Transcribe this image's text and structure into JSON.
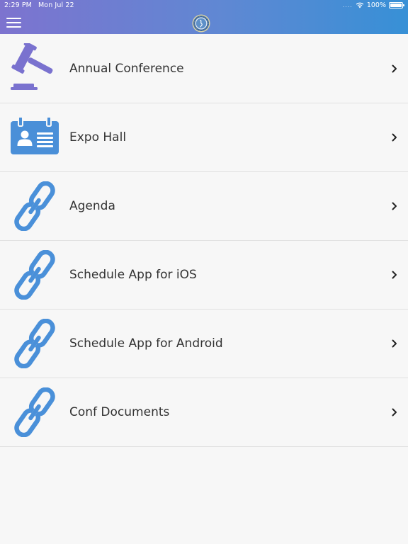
{
  "status_bar": {
    "time": "2:29 PM",
    "date": "Mon Jul 22",
    "signal": "....",
    "battery": "100%"
  },
  "header": {
    "menu_icon": "hamburger-icon",
    "logo_icon": "organization-seal-icon"
  },
  "colors": {
    "header_gradient_start": "#7d73cf",
    "header_gradient_end": "#3790d6",
    "gavel_purple": "#7a72cf",
    "expo_blue": "#4a8fd8",
    "link_blue": "#4a90d9",
    "background": "#f7f7f7",
    "text": "#333333"
  },
  "menu": {
    "items": [
      {
        "label": "Annual Conference",
        "icon": "gavel-icon"
      },
      {
        "label": "Expo Hall",
        "icon": "id-badge-icon"
      },
      {
        "label": "Agenda",
        "icon": "link-icon"
      },
      {
        "label": "Schedule App for iOS",
        "icon": "link-icon"
      },
      {
        "label": "Schedule App for Android",
        "icon": "link-icon"
      },
      {
        "label": "Conf Documents",
        "icon": "link-icon"
      }
    ]
  }
}
